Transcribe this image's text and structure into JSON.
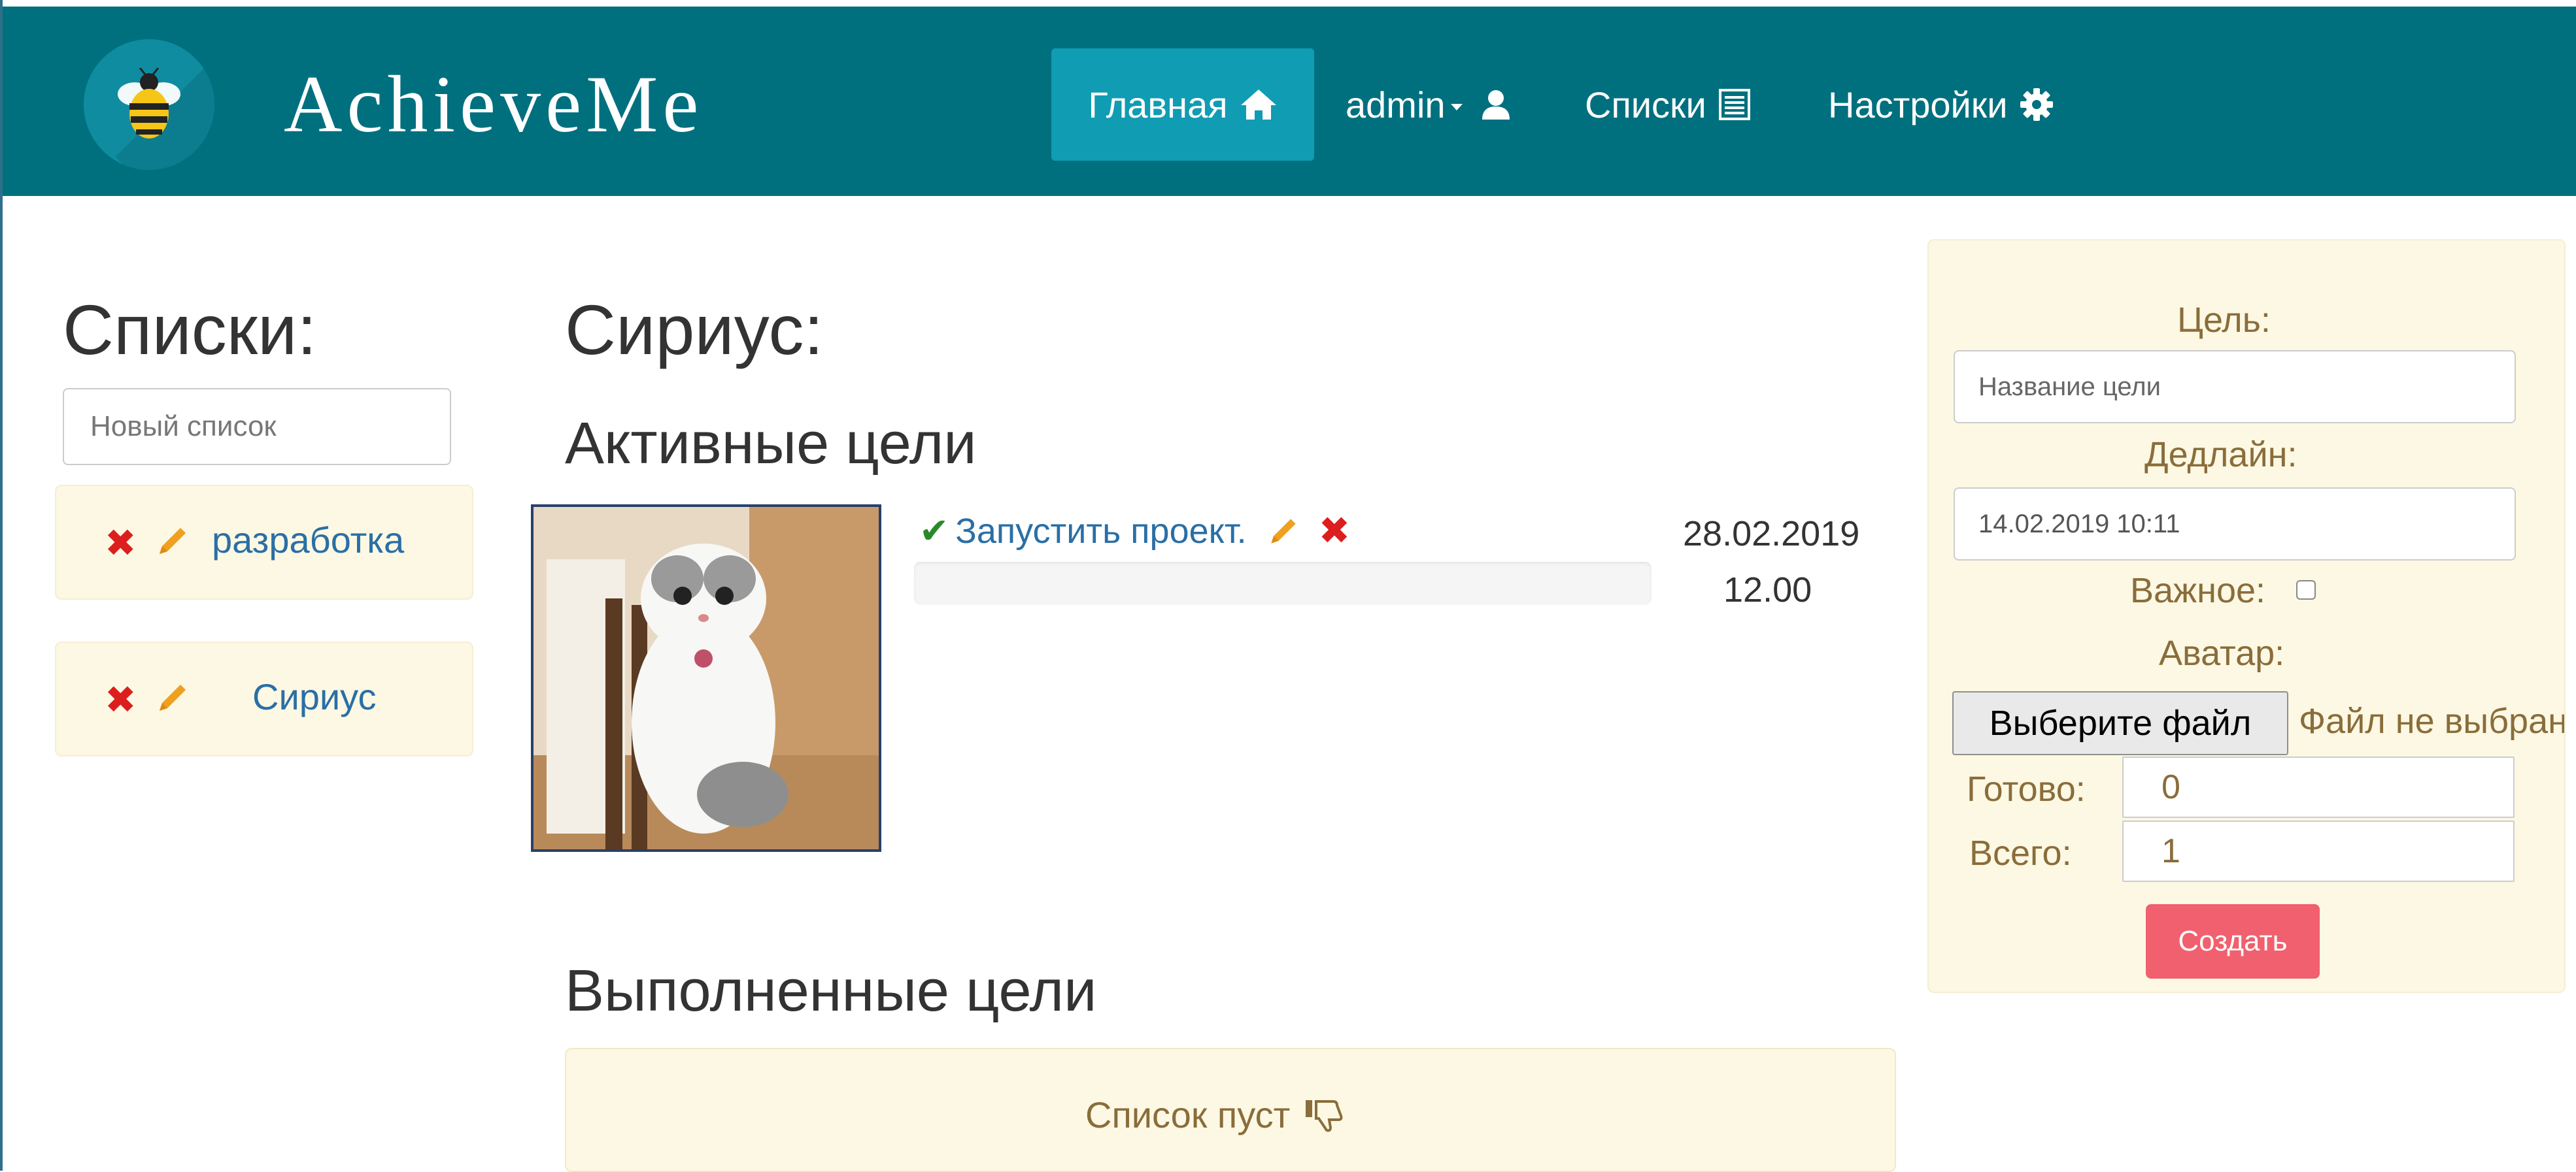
{
  "brand": {
    "name": "AchieveMe",
    "logo": "bee-logo"
  },
  "nav": {
    "home": {
      "label": "Главная",
      "icon": "home-icon"
    },
    "user": {
      "label": "admin",
      "icon": "user-icon"
    },
    "lists": {
      "label": "Списки",
      "icon": "list-icon"
    },
    "settings": {
      "label": "Настройки",
      "icon": "gear-icon"
    }
  },
  "sidebar": {
    "title": "Списки:",
    "new_list_placeholder": "Новый список",
    "lists": [
      {
        "name": "разработка"
      },
      {
        "name": "Сириус"
      }
    ]
  },
  "main": {
    "list_title": "Сириус:",
    "active_heading": "Активные цели",
    "goals": [
      {
        "title": "Запустить проект.",
        "deadline_date": "28.02.2019",
        "deadline_time": "12.00",
        "progress": 0
      }
    ],
    "done_heading": "Выполненные цели",
    "empty_text": "Список пуст"
  },
  "form": {
    "goal_label": "Цель:",
    "goal_placeholder": "Название цели",
    "deadline_label": "Дедлайн:",
    "deadline_value": "14.02.2019 10:11",
    "important_label": "Важное:",
    "avatar_label": "Аватар:",
    "file_button": "Выберите файл",
    "file_status": "Файл не выбран",
    "done_label": "Готово:",
    "done_value": "0",
    "total_label": "Всего:",
    "total_value": "1",
    "create_button": "Создать"
  },
  "colors": {
    "navbar": "#00707f",
    "nav_active": "#109cb3",
    "panel_bg": "#fcf8e3",
    "link": "#2a6fa6",
    "delete": "#dd1e1e",
    "edit": "#f0a020",
    "create_button": "#f0606e"
  }
}
